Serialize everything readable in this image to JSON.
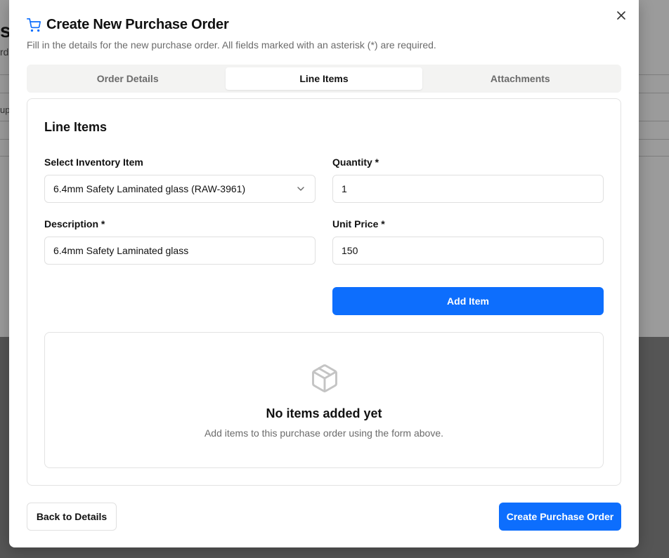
{
  "background": {
    "title_fragment": "s",
    "line_fragment": "rd",
    "row_fragment": "up"
  },
  "dialog": {
    "title": "Create New Purchase Order",
    "subtitle": "Fill in the details for the new purchase order. All fields marked with an asterisk (*) are required.",
    "title_icon": "shopping-cart-icon",
    "close_icon": "close-icon"
  },
  "tabs": [
    {
      "label": "Order Details",
      "active": false
    },
    {
      "label": "Line Items",
      "active": true
    },
    {
      "label": "Attachments",
      "active": false
    }
  ],
  "line_items": {
    "section_title": "Line Items",
    "inventory_label": "Select Inventory Item",
    "inventory_value": "6.4mm Safety Laminated glass (RAW-3961)",
    "quantity_label": "Quantity *",
    "quantity_value": "1",
    "description_label": "Description *",
    "description_value": "6.4mm Safety Laminated glass",
    "unit_price_label": "Unit Price *",
    "unit_price_value": "150",
    "add_button": "Add Item",
    "empty_icon": "package-icon",
    "empty_title": "No items added yet",
    "empty_subtitle": "Add items to this purchase order using the form above."
  },
  "footer": {
    "back_button": "Back to Details",
    "create_button": "Create Purchase Order"
  },
  "colors": {
    "accent": "#0d6efd",
    "muted_text": "#6b6b6b",
    "border": "#e3e3e3"
  }
}
